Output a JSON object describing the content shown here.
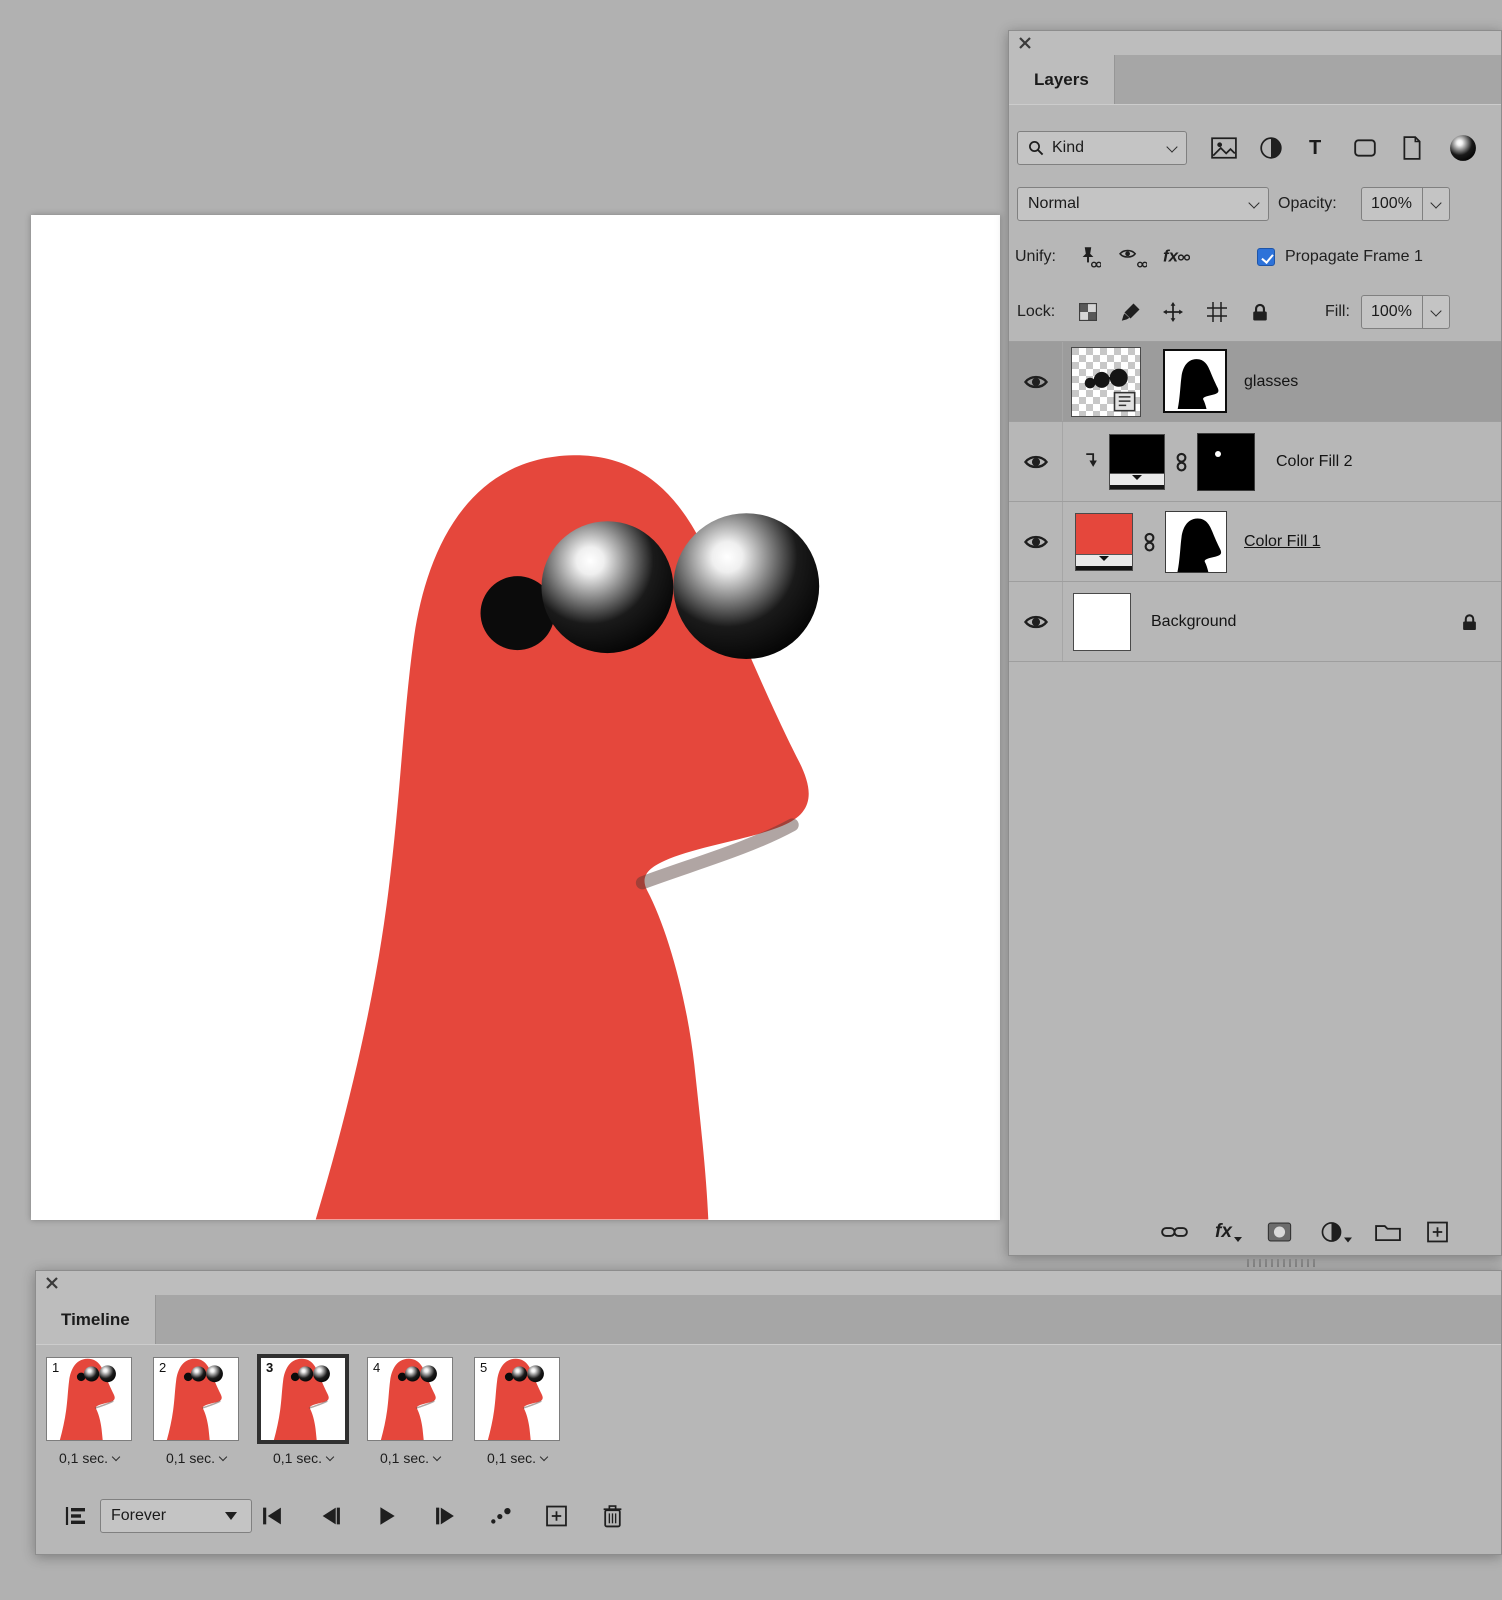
{
  "icons": {
    "type_tool": "T",
    "effects": "fx"
  },
  "layers_panel": {
    "tab_label": "Layers",
    "filter": {
      "kind_label": "Kind"
    },
    "blend_row": {
      "mode_value": "Normal",
      "opacity_label": "Opacity:",
      "opacity_value": "100%"
    },
    "unify_row": {
      "unify_label": "Unify:",
      "propagate_label": "Propagate Frame 1"
    },
    "lock_row": {
      "lock_label": "Lock:",
      "fill_label": "Fill:",
      "fill_value": "100%"
    },
    "layers": [
      {
        "name": "glasses",
        "selected": true
      },
      {
        "name": "Color Fill 2",
        "selected": false
      },
      {
        "name": "Color Fill 1",
        "selected": false
      },
      {
        "name": "Background",
        "selected": false
      }
    ]
  },
  "timeline_panel": {
    "tab_label": "Timeline",
    "loop_value": "Forever",
    "frames": [
      {
        "number": "1",
        "duration": "0,1 sec."
      },
      {
        "number": "2",
        "duration": "0,1 sec."
      },
      {
        "number": "3",
        "duration": "0,1 sec.",
        "selected": true
      },
      {
        "number": "4",
        "duration": "0,1 sec."
      },
      {
        "number": "5",
        "duration": "0,1 sec."
      }
    ]
  },
  "colors": {
    "character_red": "#e5473c",
    "checkbox_blue": "#2d72d9"
  }
}
